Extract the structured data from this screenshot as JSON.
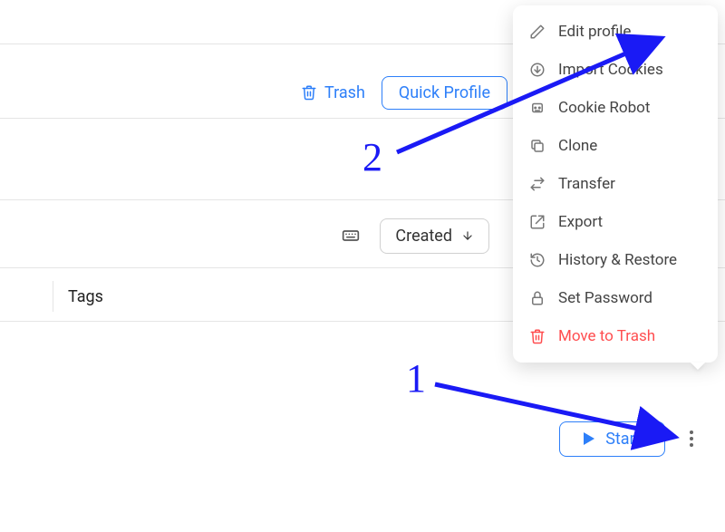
{
  "toolbar": {
    "trash_label": "Trash",
    "quick_profile_label": "Quick Profile"
  },
  "sort": {
    "label": "Created"
  },
  "columns": {
    "tags_label": "Tags"
  },
  "actions": {
    "start_label": "Start"
  },
  "menu": [
    {
      "icon": "pencil",
      "label": "Edit profile"
    },
    {
      "icon": "download",
      "label": "Import Cookies"
    },
    {
      "icon": "robot",
      "label": "Cookie Robot"
    },
    {
      "icon": "copy",
      "label": "Clone"
    },
    {
      "icon": "transfer",
      "label": "Transfer"
    },
    {
      "icon": "export",
      "label": "Export"
    },
    {
      "icon": "history",
      "label": "History & Restore"
    },
    {
      "icon": "lock",
      "label": "Set Password"
    },
    {
      "icon": "trash",
      "label": "Move to Trash",
      "danger": true
    }
  ],
  "annotations": {
    "step1": "1",
    "step2": "2"
  }
}
